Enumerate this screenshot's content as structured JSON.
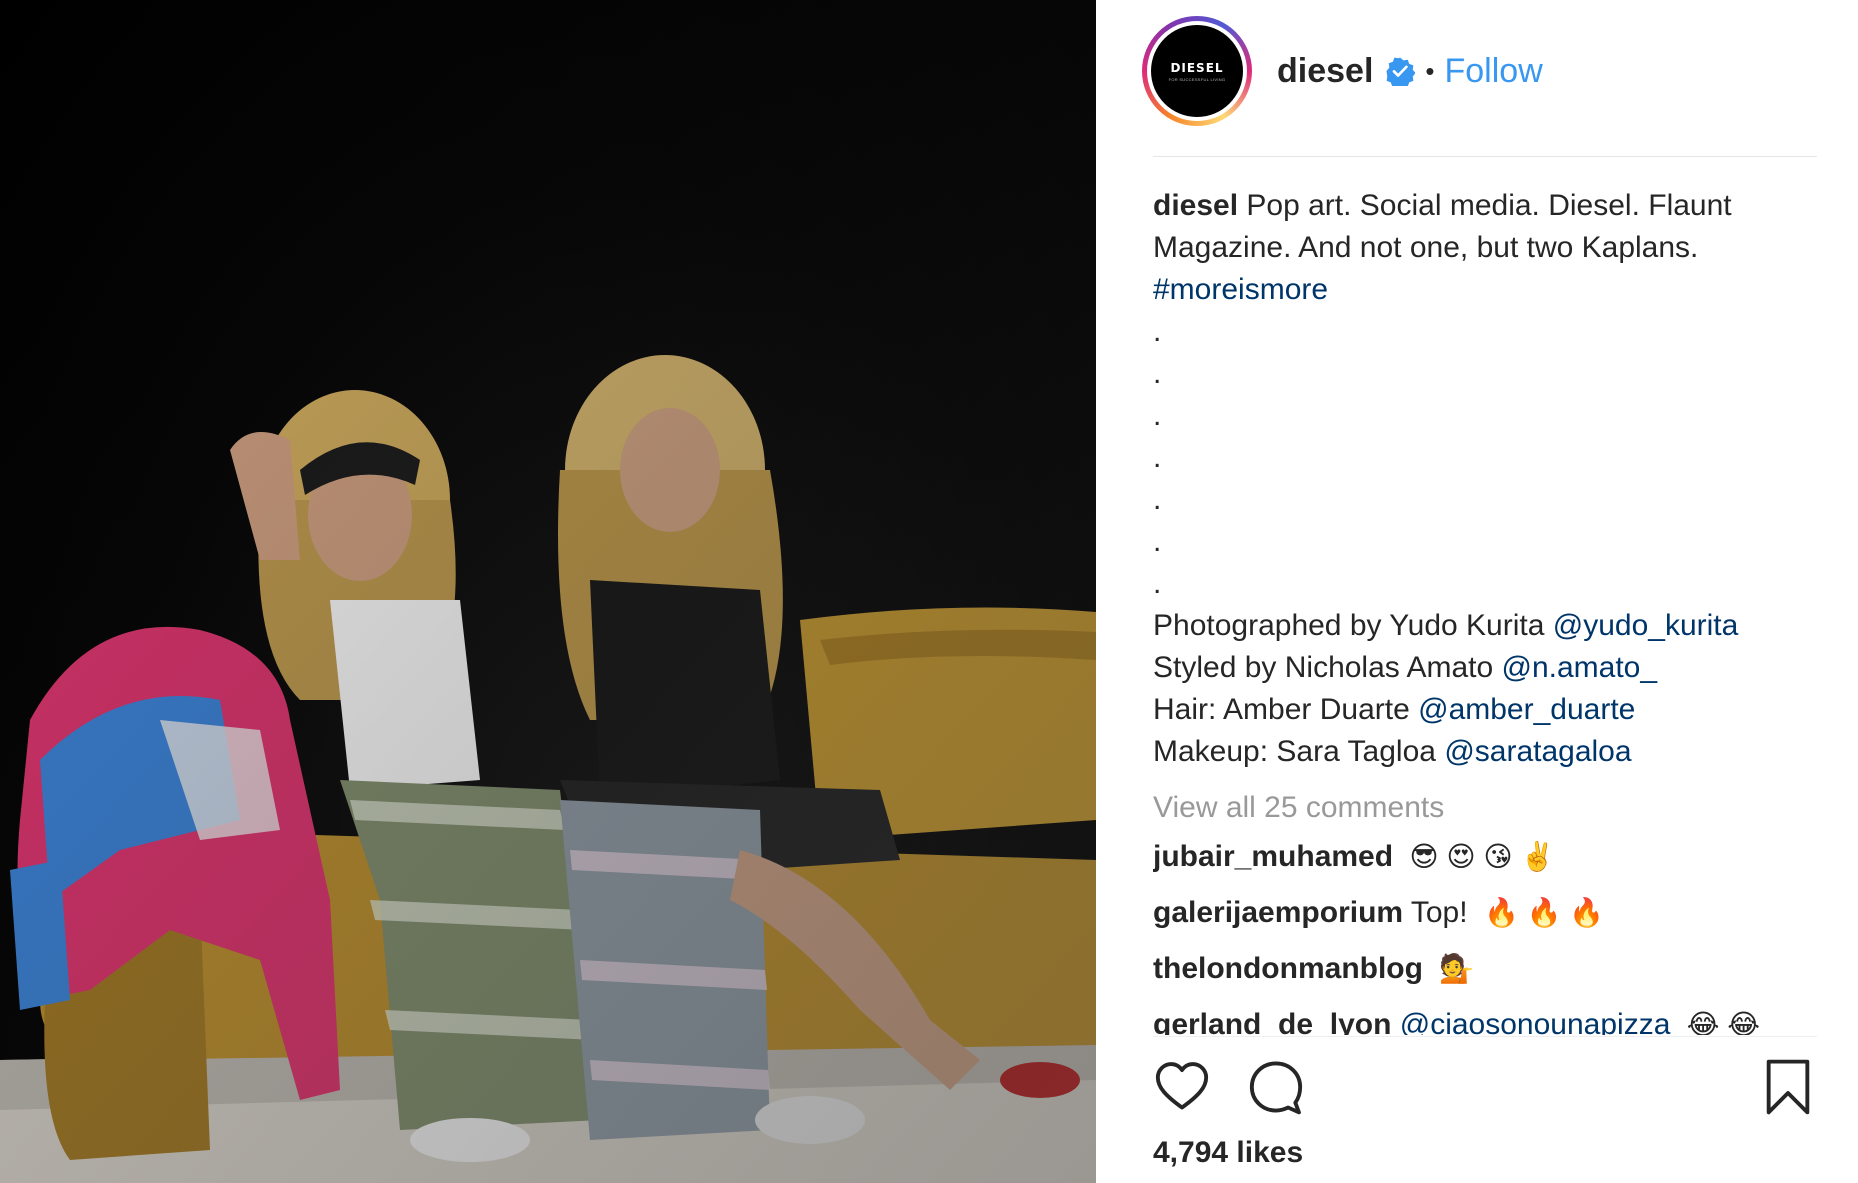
{
  "post": {
    "username": "diesel",
    "separator": "•",
    "follow_label": "Follow",
    "avatar": {
      "logo_text": "DIESEL",
      "tagline": "for successful living"
    },
    "verified_icon": "verified-badge-icon",
    "colors": {
      "link": "#3897f0",
      "hashtag": "#003569",
      "muted": "#999999",
      "text": "#262626"
    }
  },
  "caption": {
    "username": "diesel",
    "text_1": "Pop art. Social media. Diesel. Flaunt Magazine. And not one, but two Kaplans.",
    "hashtag": "#moreismore",
    "dots": [
      ".",
      ".",
      ".",
      ".",
      ".",
      ".",
      "."
    ],
    "credits": [
      {
        "text": "Photographed by Yudo Kurita",
        "mention": "@yudo_kurita"
      },
      {
        "text": "Styled by Nicholas Amato",
        "mention": "@n.amato_"
      },
      {
        "text": "Hair: Amber Duarte",
        "mention": "@amber_duarte"
      },
      {
        "text": "Makeup: Sara Tagloa",
        "mention": "@saratagaloa"
      }
    ]
  },
  "view_all_label": "View all 25 comments",
  "comments": [
    {
      "username": "jubair_muhamed",
      "text": "",
      "emoji": "😎 😍 😘 ✌️"
    },
    {
      "username": "galerijaemporium",
      "text": "Top!",
      "emoji": "🔥 🔥 🔥"
    },
    {
      "username": "thelondonmanblog",
      "text": "",
      "emoji": "💁"
    },
    {
      "username": "gerland_de_lyon",
      "text": "@ciaosonounapizza",
      "emoji": "😂 😂"
    }
  ],
  "actions": {
    "like_icon": "heart-icon",
    "comment_icon": "comment-bubble-icon",
    "save_icon": "bookmark-icon"
  },
  "likes_label": "4,794 likes"
}
